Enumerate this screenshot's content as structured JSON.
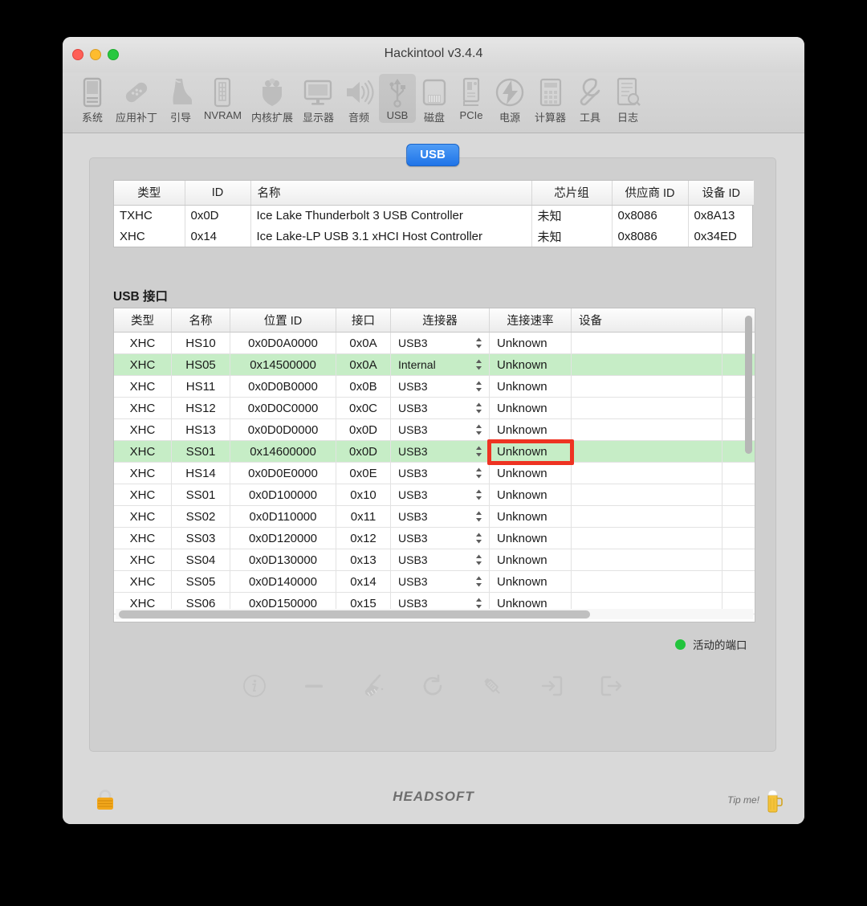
{
  "window": {
    "title": "Hackintool v3.4.4",
    "traffic_lights": [
      "close",
      "minimize",
      "zoom"
    ]
  },
  "toolbar": {
    "items": [
      {
        "label": "系统",
        "icon": "system-icon",
        "selected": false
      },
      {
        "label": "应用补丁",
        "icon": "patch-icon",
        "selected": false
      },
      {
        "label": "引导",
        "icon": "boot-icon",
        "selected": false
      },
      {
        "label": "NVRAM",
        "icon": "nvram-icon",
        "selected": false
      },
      {
        "label": "内核扩展",
        "icon": "kext-icon",
        "selected": false
      },
      {
        "label": "显示器",
        "icon": "display-icon",
        "selected": false
      },
      {
        "label": "音频",
        "icon": "audio-icon",
        "selected": false
      },
      {
        "label": "USB",
        "icon": "usb-icon",
        "selected": true
      },
      {
        "label": "磁盘",
        "icon": "disk-icon",
        "selected": false
      },
      {
        "label": "PCIe",
        "icon": "pcie-icon",
        "selected": false
      },
      {
        "label": "电源",
        "icon": "power-icon",
        "selected": false
      },
      {
        "label": "计算器",
        "icon": "calculator-icon",
        "selected": false
      },
      {
        "label": "工具",
        "icon": "tools-icon",
        "selected": false
      },
      {
        "label": "日志",
        "icon": "log-icon",
        "selected": false
      }
    ]
  },
  "panel": {
    "tab_pill": "USB"
  },
  "controllers_table": {
    "columns": [
      "类型",
      "ID",
      "名称",
      "芯片组",
      "供应商 ID",
      "设备 ID"
    ],
    "rows": [
      {
        "type": "TXHC",
        "id": "0x0D",
        "name": "Ice Lake Thunderbolt 3 USB Controller",
        "chipset": "未知",
        "vendor_id": "0x8086",
        "device_id": "0x8A13"
      },
      {
        "type": "XHC",
        "id": "0x14",
        "name": "Ice Lake-LP USB 3.1 xHCI Host Controller",
        "chipset": "未知",
        "vendor_id": "0x8086",
        "device_id": "0x34ED"
      }
    ]
  },
  "ports_section": {
    "title": "USB 接口",
    "columns": [
      "类型",
      "名称",
      "位置 ID",
      "接口",
      "连接器",
      "连接速率",
      "设备"
    ],
    "rows": [
      {
        "type": "XHC",
        "name": "HS10",
        "location_id": "0x0D0A0000",
        "port": "0x0A",
        "connector": "USB3",
        "speed": "Unknown",
        "device": "",
        "active": false
      },
      {
        "type": "XHC",
        "name": "HS05",
        "location_id": "0x14500000",
        "port": "0x0A",
        "connector": "Internal",
        "speed": "Unknown",
        "device": "",
        "active": true
      },
      {
        "type": "XHC",
        "name": "HS11",
        "location_id": "0x0D0B0000",
        "port": "0x0B",
        "connector": "USB3",
        "speed": "Unknown",
        "device": "",
        "active": false
      },
      {
        "type": "XHC",
        "name": "HS12",
        "location_id": "0x0D0C0000",
        "port": "0x0C",
        "connector": "USB3",
        "speed": "Unknown",
        "device": "",
        "active": false
      },
      {
        "type": "XHC",
        "name": "HS13",
        "location_id": "0x0D0D0000",
        "port": "0x0D",
        "connector": "USB3",
        "speed": "Unknown",
        "device": "",
        "active": false
      },
      {
        "type": "XHC",
        "name": "SS01",
        "location_id": "0x14600000",
        "port": "0x0D",
        "connector": "USB3",
        "speed": "Unknown",
        "device": "",
        "active": true
      },
      {
        "type": "XHC",
        "name": "HS14",
        "location_id": "0x0D0E0000",
        "port": "0x0E",
        "connector": "USB3",
        "speed": "Unknown",
        "device": "",
        "active": false
      },
      {
        "type": "XHC",
        "name": "SS01",
        "location_id": "0x0D100000",
        "port": "0x10",
        "connector": "USB3",
        "speed": "Unknown",
        "device": "",
        "active": false
      },
      {
        "type": "XHC",
        "name": "SS02",
        "location_id": "0x0D110000",
        "port": "0x11",
        "connector": "USB3",
        "speed": "Unknown",
        "device": "",
        "active": false
      },
      {
        "type": "XHC",
        "name": "SS03",
        "location_id": "0x0D120000",
        "port": "0x12",
        "connector": "USB3",
        "speed": "Unknown",
        "device": "",
        "active": false
      },
      {
        "type": "XHC",
        "name": "SS04",
        "location_id": "0x0D130000",
        "port": "0x13",
        "connector": "USB3",
        "speed": "Unknown",
        "device": "",
        "active": false
      },
      {
        "type": "XHC",
        "name": "SS05",
        "location_id": "0x0D140000",
        "port": "0x14",
        "connector": "USB3",
        "speed": "Unknown",
        "device": "",
        "active": false
      },
      {
        "type": "XHC",
        "name": "SS06",
        "location_id": "0x0D150000",
        "port": "0x15",
        "connector": "USB3",
        "speed": "Unknown",
        "device": "",
        "active": false
      }
    ],
    "highlight": {
      "row_index": 5,
      "column": "连接速率",
      "value": "Unknown",
      "color": "#ee3322"
    }
  },
  "legend": {
    "label": "活动的端口",
    "color": "#22c43d"
  },
  "actions": [
    {
      "name": "info-icon",
      "title": "info"
    },
    {
      "name": "minus-icon",
      "title": "remove"
    },
    {
      "name": "broom-icon",
      "title": "clean"
    },
    {
      "name": "refresh-icon",
      "title": "refresh"
    },
    {
      "name": "syringe-icon",
      "title": "inject"
    },
    {
      "name": "import-icon",
      "title": "import"
    },
    {
      "name": "export-icon",
      "title": "export"
    }
  ],
  "footer": {
    "lock_icon": "lock-icon",
    "brand": "HEADSOFT",
    "tip_label": "Tip me!",
    "tip_icon": "beer-icon"
  }
}
